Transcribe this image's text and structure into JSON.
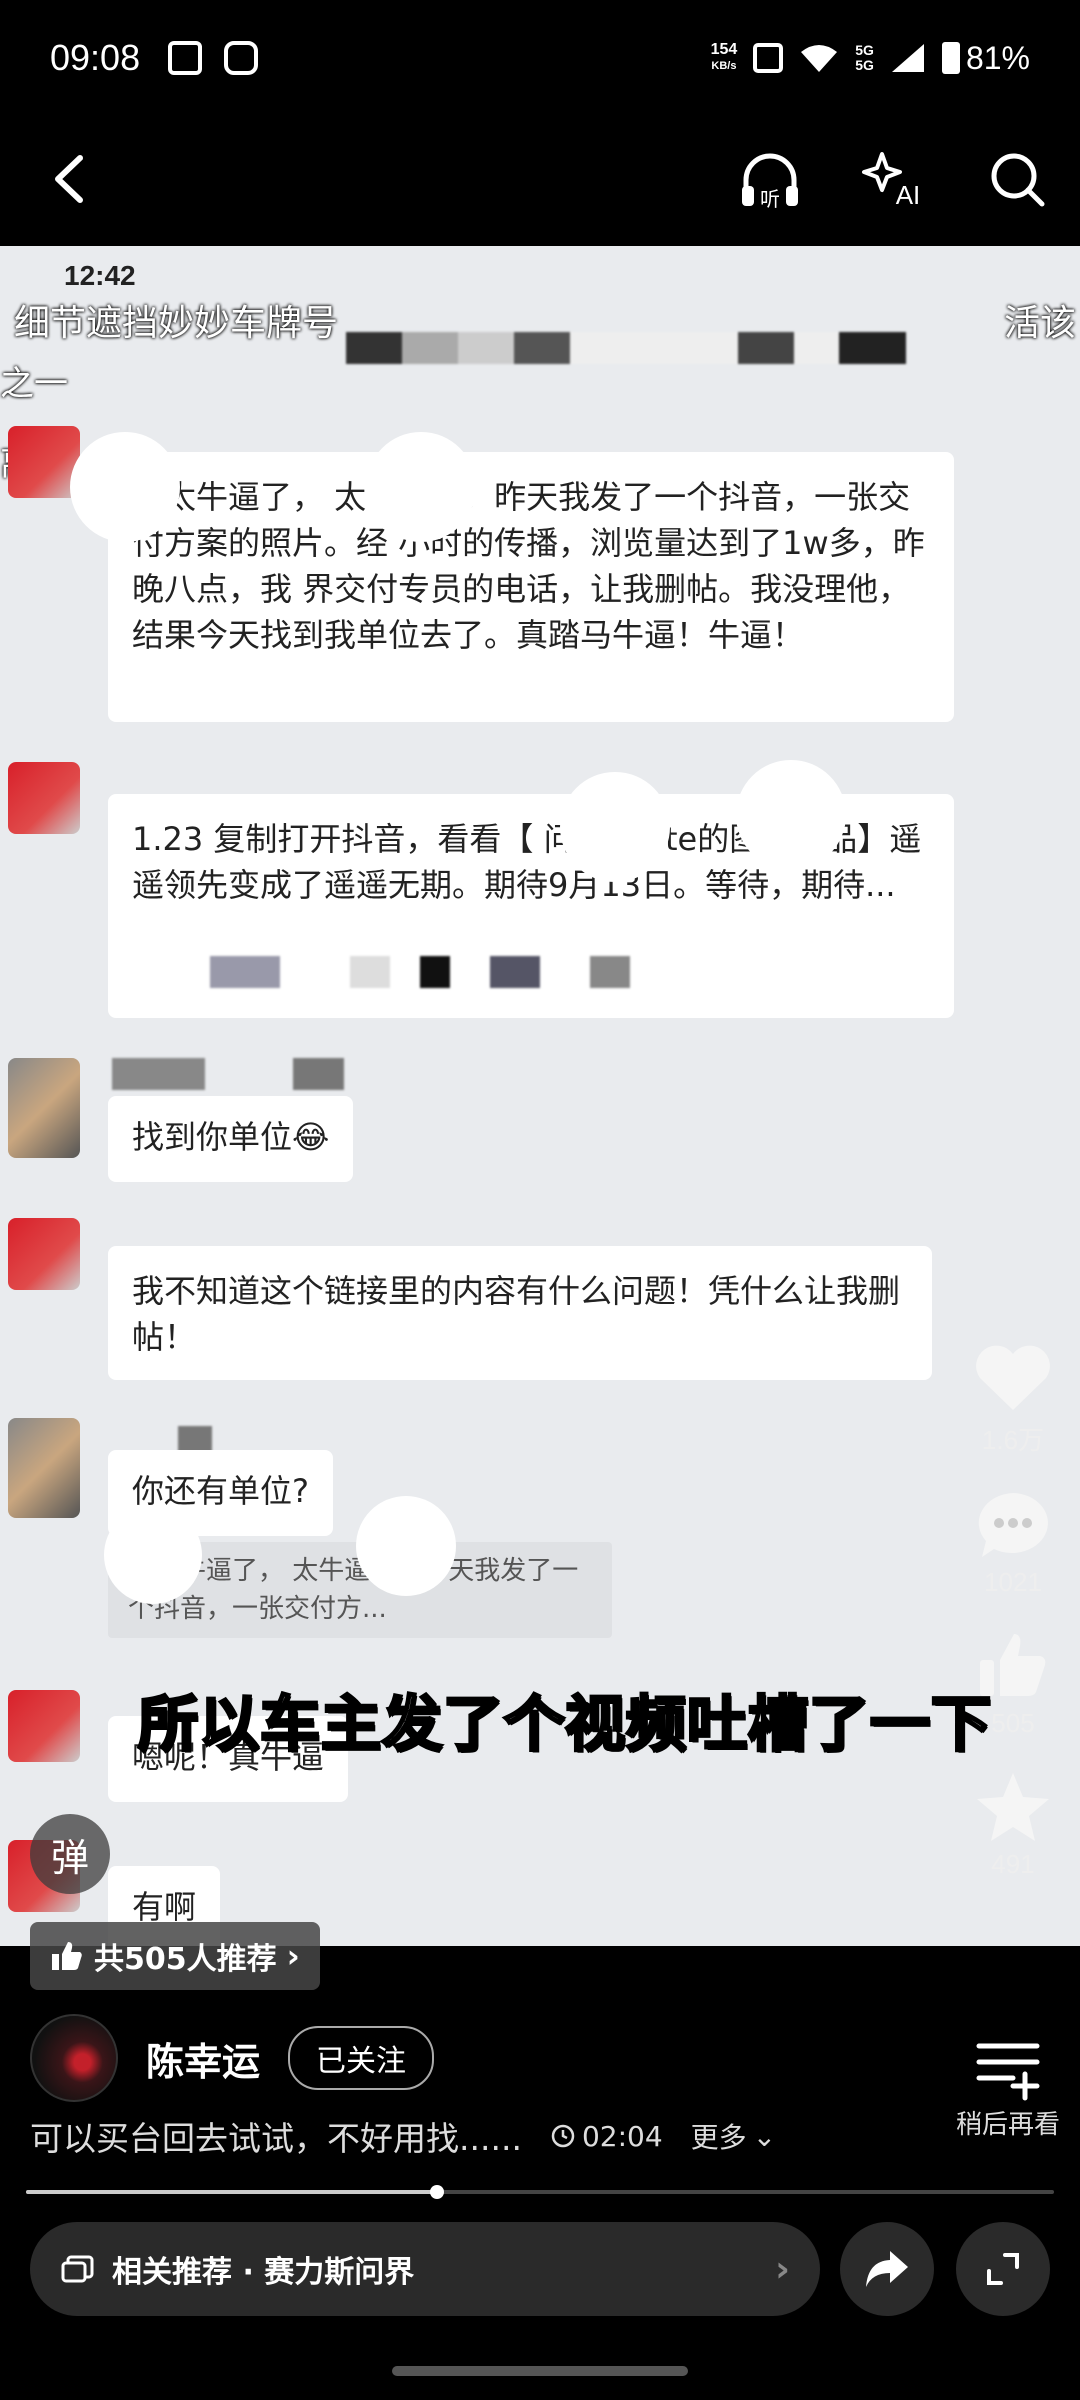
{
  "status_bar": {
    "time": "09:08",
    "net_speed_top": "154",
    "net_speed_unit": "KB/s",
    "signal_label_top": "5G",
    "signal_label_bottom": "5G",
    "battery": "81%"
  },
  "video": {
    "inner_time": "12:42",
    "subtitle_left": "细节遮挡妙妙车牌号",
    "subtitle_right": "活该",
    "sub_left_2": "之一",
    "sub_left_3": "离谱",
    "messages": [
      "为太牛逼了，      太牛逼了！昨天我发了一个抖音，一张交付方案的照片。经      小时的传播，浏览量达到了1w多，昨晚八点，我      界交付专员的电话，让我删帖。我没理他，结果今天找到我单位去了。真踏马牛逼！牛逼！",
      "1.23 复制打开抖音，看看【      问界M      ate的图文作品】遥遥领先变成了遥遥无期。期待9月13日。等待，期待...",
      "找到你单位😂",
      "我不知道这个链接里的内容有什么问题！凭什么让我删帖！",
      "你还有单位?",
      "嗯呢！真牛逼",
      "有啊"
    ],
    "quote_text": "      为太牛逼了，      太牛逼了！昨天我发了一个抖音，一张交付方...",
    "caption": "所以车主发了个视频吐槽了一下"
  },
  "actions": {
    "likes": "1.6万",
    "comments": "1021",
    "recommends": "505",
    "favorites": "491"
  },
  "danmu_label": "弹",
  "recommend_chip": "共505人推荐",
  "author": {
    "name": "陈幸运",
    "follow_label": "已关注"
  },
  "description": {
    "text": "可以买台回去试试，不好用找......",
    "duration": "02:04",
    "more": "更多"
  },
  "watch_later": "稍后再看",
  "progress": 0.4,
  "related": "相关推荐 · 赛力斯问界",
  "colors": {
    "background": "#000000",
    "video_bg": "#e9ebee",
    "like_heart": "#f5f5f5"
  }
}
